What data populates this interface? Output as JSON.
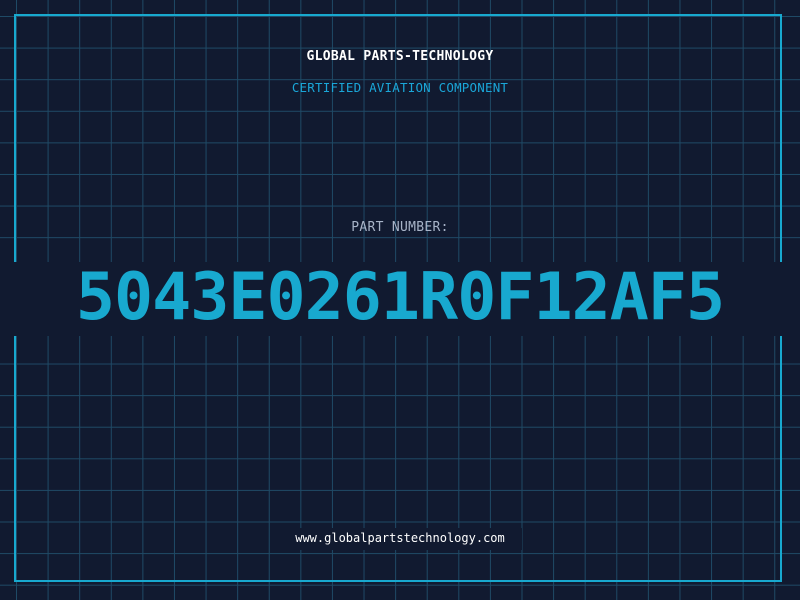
{
  "header": {
    "brand": "GLOBAL PARTS-TECHNOLOGY",
    "subtitle": "CERTIFIED AVIATION COMPONENT"
  },
  "part": {
    "label": "PART NUMBER:",
    "number": "5043E0261R0F12AF5"
  },
  "footer": {
    "url": "www.globalpartstechnology.com"
  },
  "colors": {
    "background": "#111a30",
    "grid": "#1f4a66",
    "accent": "#18a9cf",
    "text": "#ffffff",
    "muted": "#a8b4c8"
  }
}
